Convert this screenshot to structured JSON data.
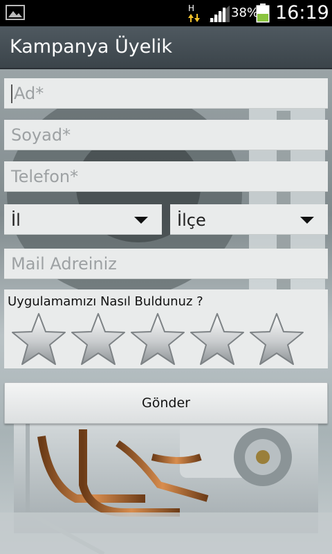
{
  "status_bar": {
    "network_label": "H",
    "battery_percent": "38%",
    "time": "16:19",
    "icons": [
      "image-icon",
      "network-h-icon",
      "signal-icon",
      "battery-icon"
    ]
  },
  "action_bar": {
    "title": "Kampanya Üyelik"
  },
  "form": {
    "first_name_placeholder": "Ad*",
    "last_name_placeholder": "Soyad*",
    "phone_placeholder": "Telefon*",
    "province_selected": "İl",
    "district_selected": "İlçe",
    "email_placeholder": "Mail Adreiniz",
    "rating_question": "Uygulamamızı Nasıl Buldunuz ?",
    "rating_value": 0,
    "rating_max": 5,
    "submit_label": "Gönder"
  },
  "colors": {
    "field_bg": "#e9ebeb",
    "placeholder": "#9da1a3",
    "action_bar": "#444d53",
    "battery_fill": "#8ac43f"
  }
}
